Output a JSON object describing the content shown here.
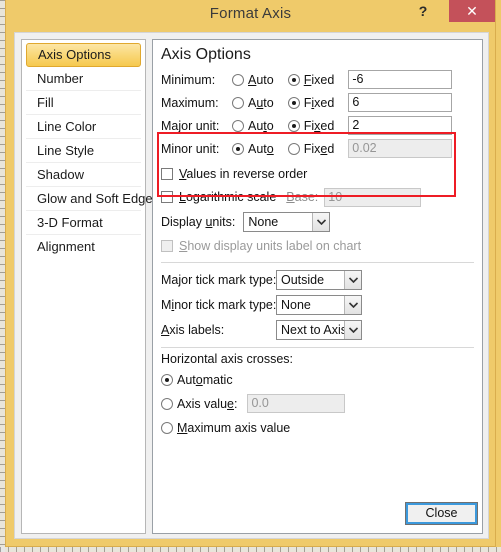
{
  "window": {
    "title": "Format Axis",
    "help_label": "?",
    "close_glyph": "✕",
    "accent_gold": "#EFCA6A",
    "close_red": "#C4515A",
    "highlight_red": "#EE1C25"
  },
  "sidebar": {
    "items": [
      {
        "label": "Axis Options",
        "selected": true
      },
      {
        "label": "Number",
        "selected": false
      },
      {
        "label": "Fill",
        "selected": false
      },
      {
        "label": "Line Color",
        "selected": false
      },
      {
        "label": "Line Style",
        "selected": false
      },
      {
        "label": "Shadow",
        "selected": false
      },
      {
        "label": "Glow and Soft Edges",
        "selected": false
      },
      {
        "label": "3-D Format",
        "selected": false
      },
      {
        "label": "Alignment",
        "selected": false
      }
    ]
  },
  "pane": {
    "title": "Axis Options",
    "scale_rows": [
      {
        "label": "Minimum:",
        "auto_label": "Auto",
        "fixed_label": "Fixed",
        "selected": "fixed",
        "value": "-6",
        "disabled": false
      },
      {
        "label": "Maximum:",
        "auto_label": "Auto",
        "fixed_label": "Fixed",
        "selected": "fixed",
        "value": "6",
        "disabled": false
      },
      {
        "label": "Major unit:",
        "auto_label": "Auto",
        "fixed_label": "Fixed",
        "selected": "fixed",
        "value": "2",
        "disabled": false
      },
      {
        "label": "Minor unit:",
        "auto_label": "Auto",
        "fixed_label": "Fixed",
        "selected": "auto",
        "value": "0.02",
        "disabled": true
      }
    ],
    "reverse_order": {
      "label": "Values in reverse order",
      "checked": false
    },
    "logarithmic": {
      "label": "Logarithmic scale",
      "checked": false,
      "base_label": "Base:",
      "base_value": "10",
      "base_disabled": true
    },
    "display_units": {
      "label": "Display units:",
      "value": "None"
    },
    "show_units_label": {
      "label": "Show display units label on chart",
      "checked": false,
      "disabled": true
    },
    "major_tick": {
      "label": "Major tick mark type:",
      "value": "Outside"
    },
    "minor_tick": {
      "label": "Minor tick mark type:",
      "value": "None"
    },
    "axis_labels": {
      "label": "Axis labels:",
      "value": "Next to Axis"
    },
    "crosses": {
      "heading": "Horizontal axis crosses:",
      "options": [
        {
          "label": "Automatic",
          "selected": true
        },
        {
          "label": "Axis value:",
          "selected": false,
          "value": "0.0",
          "disabled": true
        },
        {
          "label": "Maximum axis value",
          "selected": false
        }
      ]
    }
  },
  "footer": {
    "close_label": "Close"
  }
}
